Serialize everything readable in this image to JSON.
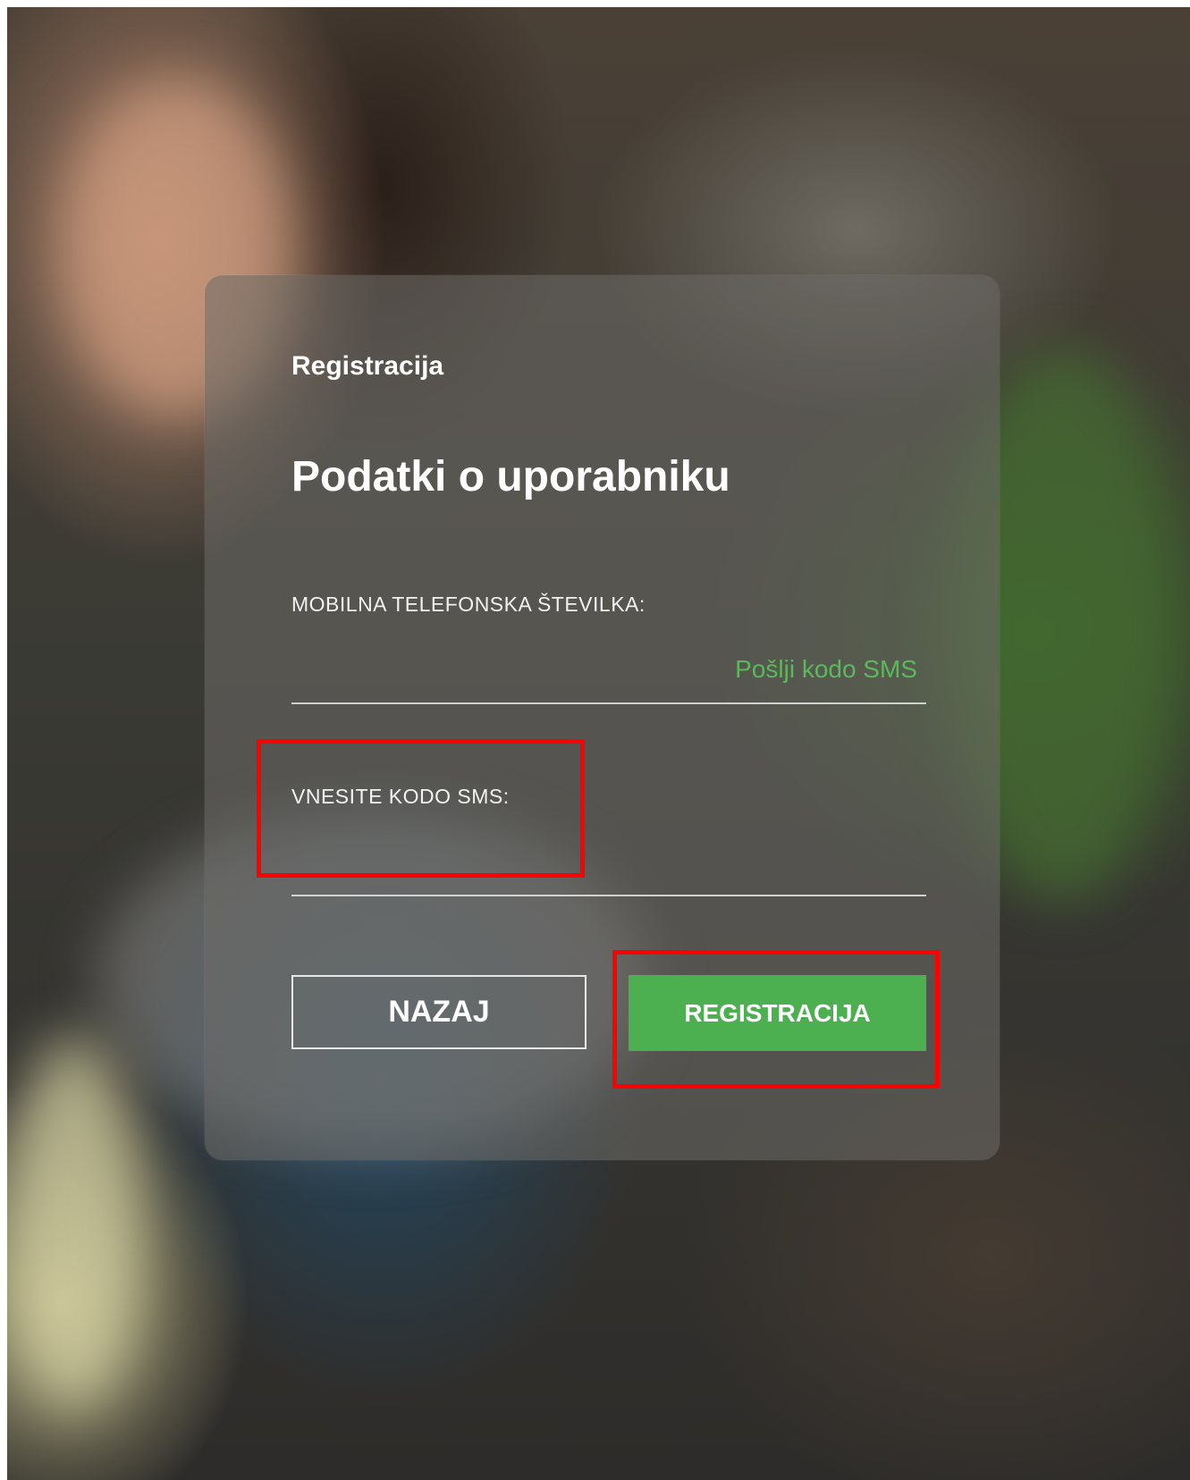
{
  "form": {
    "breadcrumb": "Registracija",
    "title": "Podatki o uporabniku",
    "phone": {
      "label": "MOBILNA TELEFONSKA ŠTEVILKA:",
      "value": "",
      "send_link": "Pošlji kodo SMS"
    },
    "sms_code": {
      "label": "VNESITE KODO SMS:",
      "value": ""
    },
    "back_button": "NAZAJ",
    "register_button": "REGISTRACIJA"
  },
  "colors": {
    "accent_green": "#4caf50",
    "link_green": "#5cb85c",
    "highlight_red": "#ff0000"
  }
}
